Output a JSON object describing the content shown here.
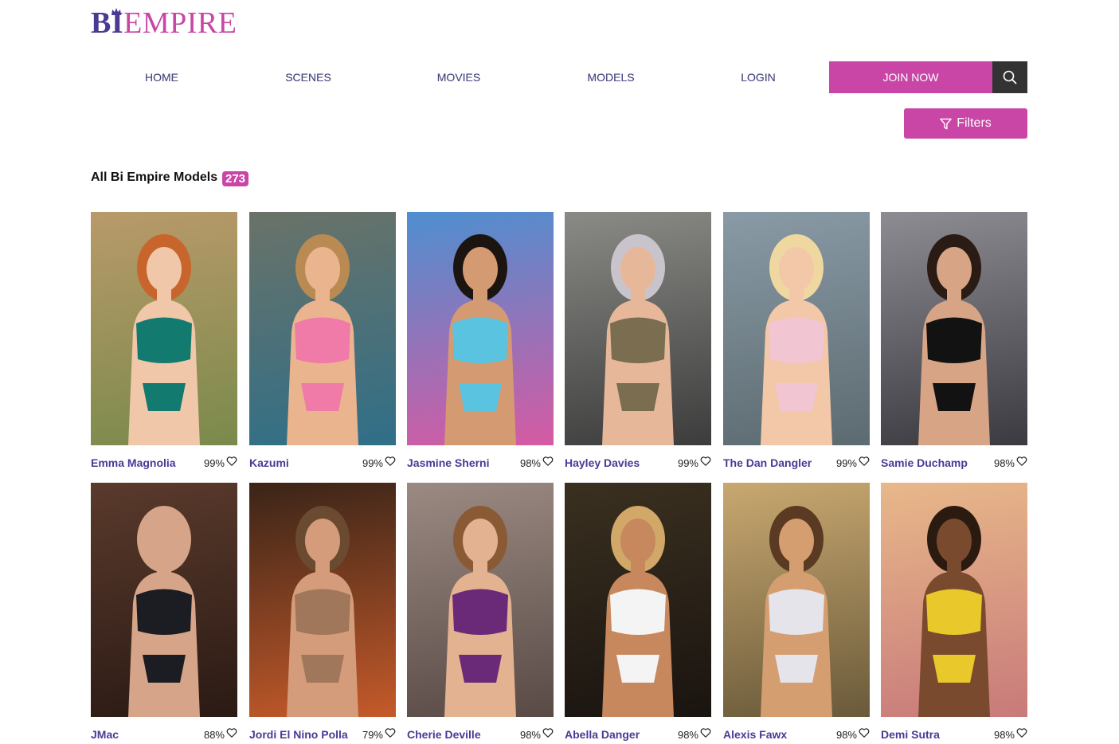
{
  "logo": {
    "part1": "BI",
    "part2": "EMPIRE"
  },
  "nav": {
    "items": [
      {
        "label": "HOME"
      },
      {
        "label": "SCENES"
      },
      {
        "label": "MOVIES"
      },
      {
        "label": "MODELS"
      },
      {
        "label": "LOGIN"
      }
    ],
    "join_label": "JOIN NOW",
    "search_icon": "search-icon"
  },
  "filters": {
    "label": "Filters",
    "icon": "filter-icon"
  },
  "section": {
    "title": "All Bi Empire Models",
    "count": "273"
  },
  "colors": {
    "accent": "#c946a6",
    "brand_purple": "#4a3a94",
    "dark": "#333333"
  },
  "models": [
    {
      "name": "Emma Magnolia",
      "rating": "99%",
      "bg": "#b99a6a",
      "bg2": "#7a8a4a",
      "outfit": "#127a6e",
      "skin": "#f0c7a8",
      "hair": "#c8652c"
    },
    {
      "name": "Kazumi",
      "rating": "99%",
      "bg": "#6a7268",
      "bg2": "#2f6f88",
      "outfit": "#f07aa8",
      "skin": "#e9b48e",
      "hair": "#b98a52"
    },
    {
      "name": "Jasmine Sherni",
      "rating": "98%",
      "bg": "#4d8fd0",
      "bg2": "#d65aa3",
      "outfit": "#5ac3e0",
      "skin": "#d49a72",
      "hair": "#1c1410"
    },
    {
      "name": "Hayley Davies",
      "rating": "99%",
      "bg": "#8a8a86",
      "bg2": "#3c3c3c",
      "outfit": "#7a6d50",
      "skin": "#e6b899",
      "hair": "#c9c4cc"
    },
    {
      "name": "The Dan Dangler",
      "rating": "99%",
      "bg": "#8a9aa6",
      "bg2": "#5c6b70",
      "outfit": "#f2c5d2",
      "skin": "#f2c8a8",
      "hair": "#efd8a0"
    },
    {
      "name": "Samie Duchamp",
      "rating": "98%",
      "bg": "#8c8c92",
      "bg2": "#3a3a40",
      "outfit": "#121212",
      "skin": "#d7a585",
      "hair": "#2a1b14"
    },
    {
      "name": "JMac",
      "rating": "88%",
      "bg": "#5a3a2c",
      "bg2": "#2a1a14",
      "outfit": "#1c1d22",
      "skin": "#d6a488",
      "hair": "#d6a488"
    },
    {
      "name": "Jordi El Nino Polla",
      "rating": "79%",
      "bg": "#3a2418",
      "bg2": "#c55a2a",
      "outfit": "#a0775a",
      "skin": "#d49c7a",
      "hair": "#6a4a30"
    },
    {
      "name": "Cherie Deville",
      "rating": "98%",
      "bg": "#9a8a82",
      "bg2": "#5a4a46",
      "outfit": "#6a2a78",
      "skin": "#e3b290",
      "hair": "#8a5a34"
    },
    {
      "name": "Abella Danger",
      "rating": "98%",
      "bg": "#3a3020",
      "bg2": "#1a1410",
      "outfit": "#f4f4f4",
      "skin": "#c7885e",
      "hair": "#d2a868"
    },
    {
      "name": "Alexis Fawx",
      "rating": "98%",
      "bg": "#c8a870",
      "bg2": "#6a5a3a",
      "outfit": "#e4e4ea",
      "skin": "#d49e70",
      "hair": "#5a3a22"
    },
    {
      "name": "Demi Sutra",
      "rating": "98%",
      "bg": "#e8b88a",
      "bg2": "#c87a7a",
      "outfit": "#e8c82a",
      "skin": "#7a4a2e",
      "hair": "#2a1a10"
    }
  ]
}
